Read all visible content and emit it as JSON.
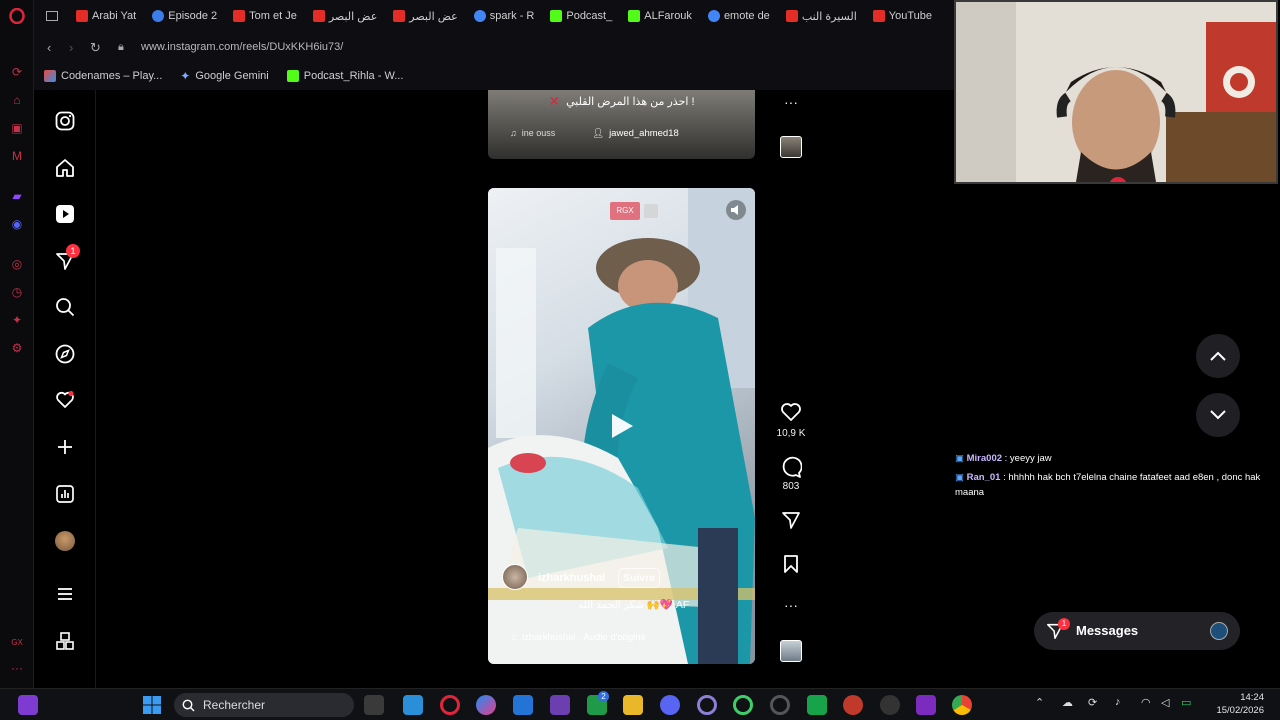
{
  "browser": {
    "tabs": [
      {
        "label": "Arabi Yat",
        "color": "#e52d27"
      },
      {
        "label": "Episode 2",
        "color": "#3b7ee8"
      },
      {
        "label": "Tom et Je",
        "color": "#e52d27"
      },
      {
        "label": "عض البصر",
        "color": "#e52d27"
      },
      {
        "label": "عض البصر",
        "color": "#e52d27"
      },
      {
        "label": "spark - R",
        "color": "#4285f4"
      },
      {
        "label": "Podcast_",
        "color": "#53fc18"
      },
      {
        "label": "ALFarouk",
        "color": "#53fc18"
      },
      {
        "label": "emote de",
        "color": "#4285f4"
      },
      {
        "label": "السيرة النب",
        "color": "#e52d27"
      },
      {
        "label": "YouTube",
        "color": "#e52d27"
      }
    ],
    "url": "www.instagram.com/reels/DUxKKH6iu73/",
    "bookmarks": [
      {
        "label": "Codenames – Play...",
        "icon": "codenames-icon"
      },
      {
        "label": "Google Gemini",
        "icon": "gemini-icon"
      },
      {
        "label": "Podcast_Rihla - W...",
        "icon": "kick-icon"
      }
    ]
  },
  "reel_top": {
    "caption": "احذر من هذا المرض القلبي !",
    "audio": "ine ouss",
    "user": "jawed_ahmed18"
  },
  "reel_main": {
    "badge": "RGX",
    "username": "izharkhushal",
    "follow": "Suivre",
    "caption": "شكر الحمد الله 🙌💖 AF",
    "audio": "izharkhushal · Audio d'origine",
    "likes": "10,9 K",
    "comments": "803"
  },
  "chat": [
    {
      "user": "Mira002",
      "text": " : yeeyy jaw"
    },
    {
      "user": "Ran_01",
      "text": " : hhhhh hak bch t7elelna chaine fatafeet aad e8en , donc hak maana"
    }
  ],
  "messages": {
    "label": "Messages",
    "badge": "1"
  },
  "notif_badge": "1",
  "taskbar": {
    "search": "Rechercher",
    "time": "14:24",
    "date": "15/02/2026",
    "teams_badge": "2"
  }
}
